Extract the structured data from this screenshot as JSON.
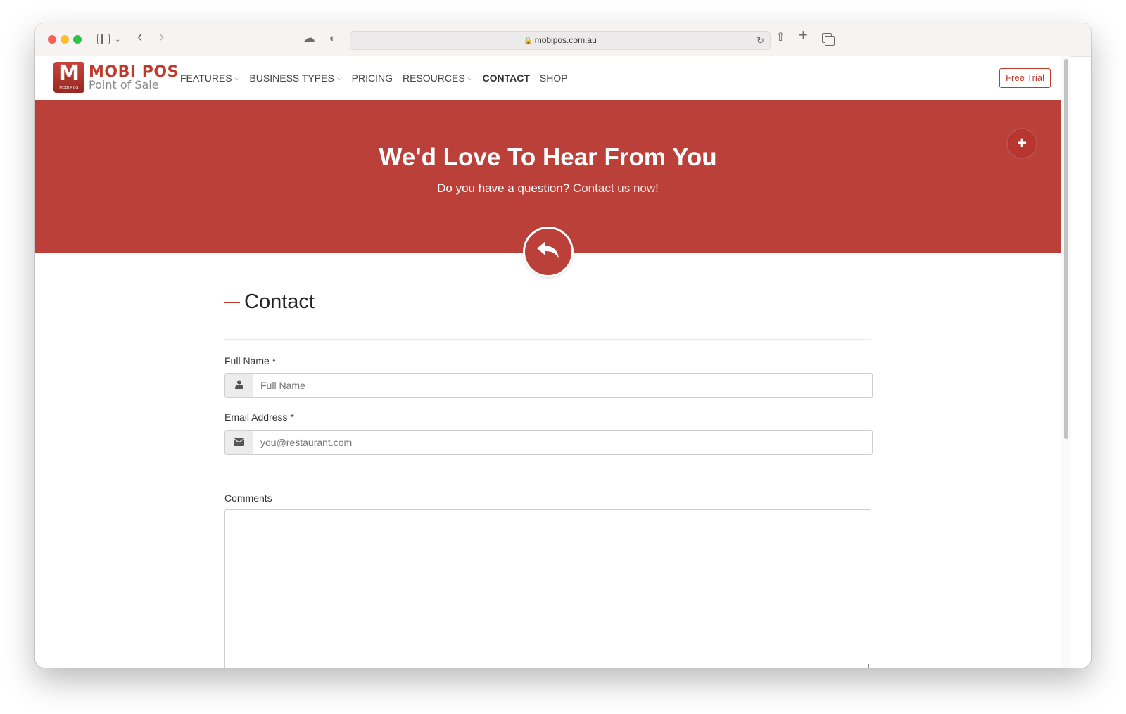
{
  "browser": {
    "url": "mobipos.com.au"
  },
  "site": {
    "logo_mark": "M",
    "logo_mark_sub": "MOBI POS",
    "logo_title": "MOBI POS",
    "logo_tagline": "Point of Sale",
    "nav": [
      {
        "label": "FEATURES",
        "dropdown": true
      },
      {
        "label": "BUSINESS TYPES",
        "dropdown": true
      },
      {
        "label": "PRICING",
        "dropdown": false
      },
      {
        "label": "RESOURCES",
        "dropdown": true
      },
      {
        "label": "CONTACT",
        "dropdown": false,
        "active": true
      },
      {
        "label": "SHOP",
        "dropdown": false
      }
    ],
    "free_trial_label": "Free Trial",
    "brand_color": "#bc403a"
  },
  "hero": {
    "title": "We'd Love To Hear From You",
    "subtitle_prefix": "Do you have a question?",
    "subtitle_link": "Contact us now!"
  },
  "form": {
    "section_title": "Contact",
    "full_name_label": "Full Name *",
    "full_name_placeholder": "Full Name",
    "email_label": "Email Address *",
    "email_placeholder": "you@restaurant.com",
    "comments_label": "Comments"
  }
}
